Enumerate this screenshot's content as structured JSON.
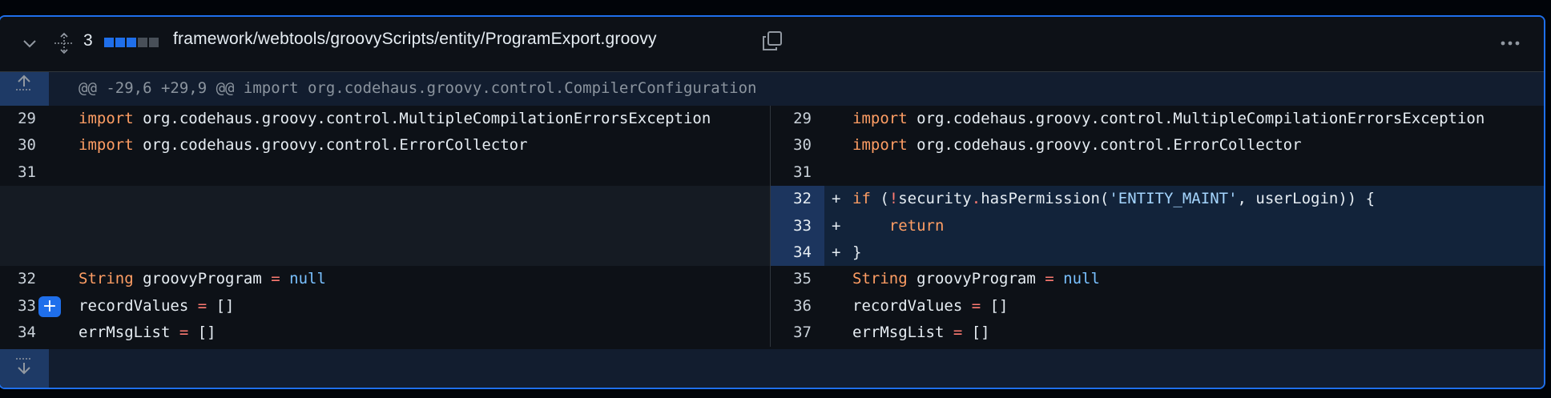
{
  "file": {
    "changes_count": "3",
    "path": "framework/webtools/groovyScripts/entity/ProgramExport.groovy",
    "diffstat_colors": [
      "#1f6feb",
      "#1f6feb",
      "#1f6feb",
      "#484f58",
      "#484f58"
    ],
    "icons": {
      "collapse": "chevron-down-icon",
      "move": "move-icon",
      "copy": "copy-icon",
      "more": "kebab-icon",
      "expand_up": "expand-up-icon",
      "expand_down": "expand-down-icon",
      "add_comment": "plus-icon"
    }
  },
  "hunk": {
    "header": "@@ -29,6 +29,9 @@ import org.codehaus.groovy.control.CompilerConfiguration"
  },
  "rows": [
    {
      "left_ln": "29",
      "left_code": "import org.codehaus.groovy.control.MultipleCompilationErrorsException",
      "right_ln": "29",
      "right_code": "import org.codehaus.groovy.control.MultipleCompilationErrorsException"
    },
    {
      "left_ln": "30",
      "left_code": "import org.codehaus.groovy.control.ErrorCollector",
      "right_ln": "30",
      "right_code": "import org.codehaus.groovy.control.ErrorCollector"
    },
    {
      "left_ln": "31",
      "left_code": "",
      "right_ln": "31",
      "right_code": ""
    },
    {
      "left_ln": "",
      "left_code": "",
      "right_ln": "32",
      "right_marker": "+",
      "right_code": "if (!security.hasPermission('ENTITY_MAINT', userLogin)) {"
    },
    {
      "left_ln": "",
      "left_code": "",
      "right_ln": "33",
      "right_marker": "+",
      "right_code": "    return"
    },
    {
      "left_ln": "",
      "left_code": "",
      "right_ln": "34",
      "right_marker": "+",
      "right_code": "}"
    },
    {
      "left_ln": "32",
      "left_code": "String groovyProgram = null",
      "right_ln": "35",
      "right_code": "String groovyProgram = null"
    },
    {
      "left_ln": "33",
      "left_code": "recordValues = []",
      "right_ln": "36",
      "right_code": "recordValues = []"
    },
    {
      "left_ln": "34",
      "left_code": "errMsgList = []",
      "right_ln": "37",
      "right_code": "errMsgList = []"
    }
  ]
}
